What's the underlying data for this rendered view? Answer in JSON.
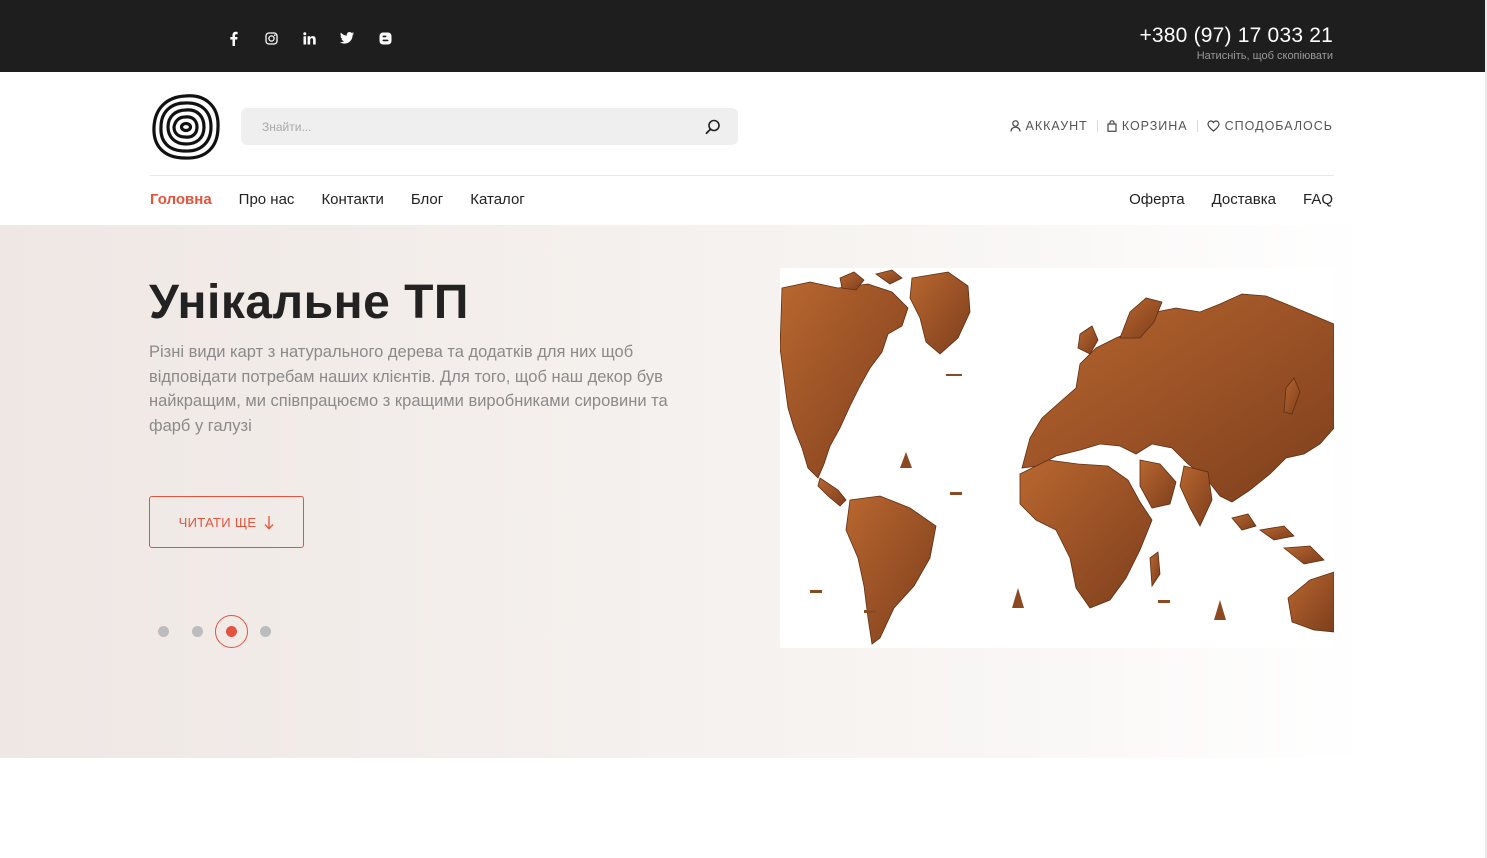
{
  "topbar": {
    "socials": [
      {
        "icon": "facebook-icon"
      },
      {
        "icon": "instagram-icon"
      },
      {
        "icon": "linkedin-icon"
      },
      {
        "icon": "twitter-icon"
      },
      {
        "icon": "blogger-icon"
      }
    ],
    "phone": "+380 (97) 17 033 21",
    "phone_hint": "Натисніть, щоб скопіювати"
  },
  "header": {
    "search_placeholder": "Знайти...",
    "user_links": {
      "account": "АККАУНТ",
      "cart": "КОРЗИНА",
      "liked": "СПОДОБАЛОСЬ"
    }
  },
  "nav": {
    "left": [
      "Головна",
      "Про нас",
      "Контакти",
      "Блог",
      "Каталог"
    ],
    "right": [
      "Оферта",
      "Доставка",
      "FAQ"
    ],
    "active": "Головна"
  },
  "hero": {
    "title": "Унікальне ТП",
    "text": "Різні види карт з натурального дерева та додатків для них щоб відповідати потребам наших клієнтів. Для того, щоб наш декор був найкращим, ми співпрацюємо з кращими виробниками сировини та фарб у галузі",
    "button": "ЧИТАТИ ЩЕ",
    "slides_total": 4,
    "active_slide": 3
  },
  "colors": {
    "accent": "#e5533c",
    "topbar": "#1e1e1e",
    "wood": "#a0522d"
  }
}
